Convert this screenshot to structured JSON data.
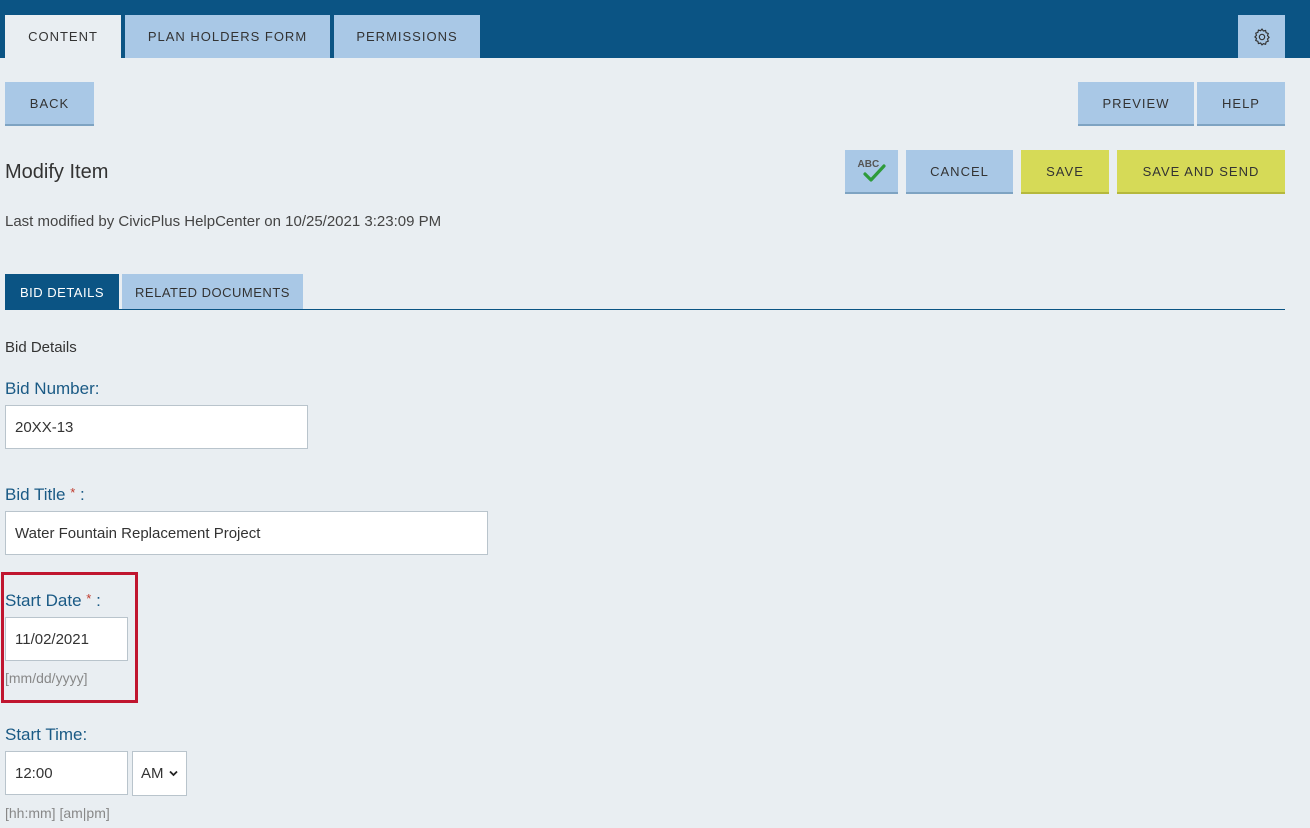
{
  "topnav": {
    "tabs": [
      {
        "label": "CONTENT"
      },
      {
        "label": "PLAN HOLDERS FORM"
      },
      {
        "label": "PERMISSIONS"
      }
    ]
  },
  "toolbar": {
    "back_label": "BACK",
    "preview_label": "PREVIEW",
    "help_label": "HELP",
    "spellcheck_text": "ABC",
    "cancel_label": "CANCEL",
    "save_label": "SAVE",
    "save_send_label": "SAVE AND SEND"
  },
  "page": {
    "title": "Modify Item",
    "last_modified": "Last modified by CivicPlus HelpCenter on 10/25/2021 3:23:09 PM"
  },
  "subtabs": [
    {
      "label": "BID DETAILS"
    },
    {
      "label": "RELATED DOCUMENTS"
    }
  ],
  "form": {
    "section": "Bid Details",
    "bid_number": {
      "label": "Bid Number:",
      "value": "20XX-13"
    },
    "bid_title": {
      "label": "Bid Title",
      "required": "*",
      "suffix": " :",
      "value": "Water Fountain Replacement Project"
    },
    "start_date": {
      "label": "Start Date",
      "required": "*",
      "suffix": " :",
      "value": "11/02/2021",
      "hint": "[mm/dd/yyyy]"
    },
    "start_time": {
      "label": "Start Time:",
      "value": "12:00",
      "ampm": "AM",
      "hint": "[hh:mm] [am|pm]"
    }
  },
  "colors": {
    "topbar": "#0b5484",
    "tab": "#a9c8e6",
    "save": "#d6da57",
    "highlight": "#c0152f"
  }
}
